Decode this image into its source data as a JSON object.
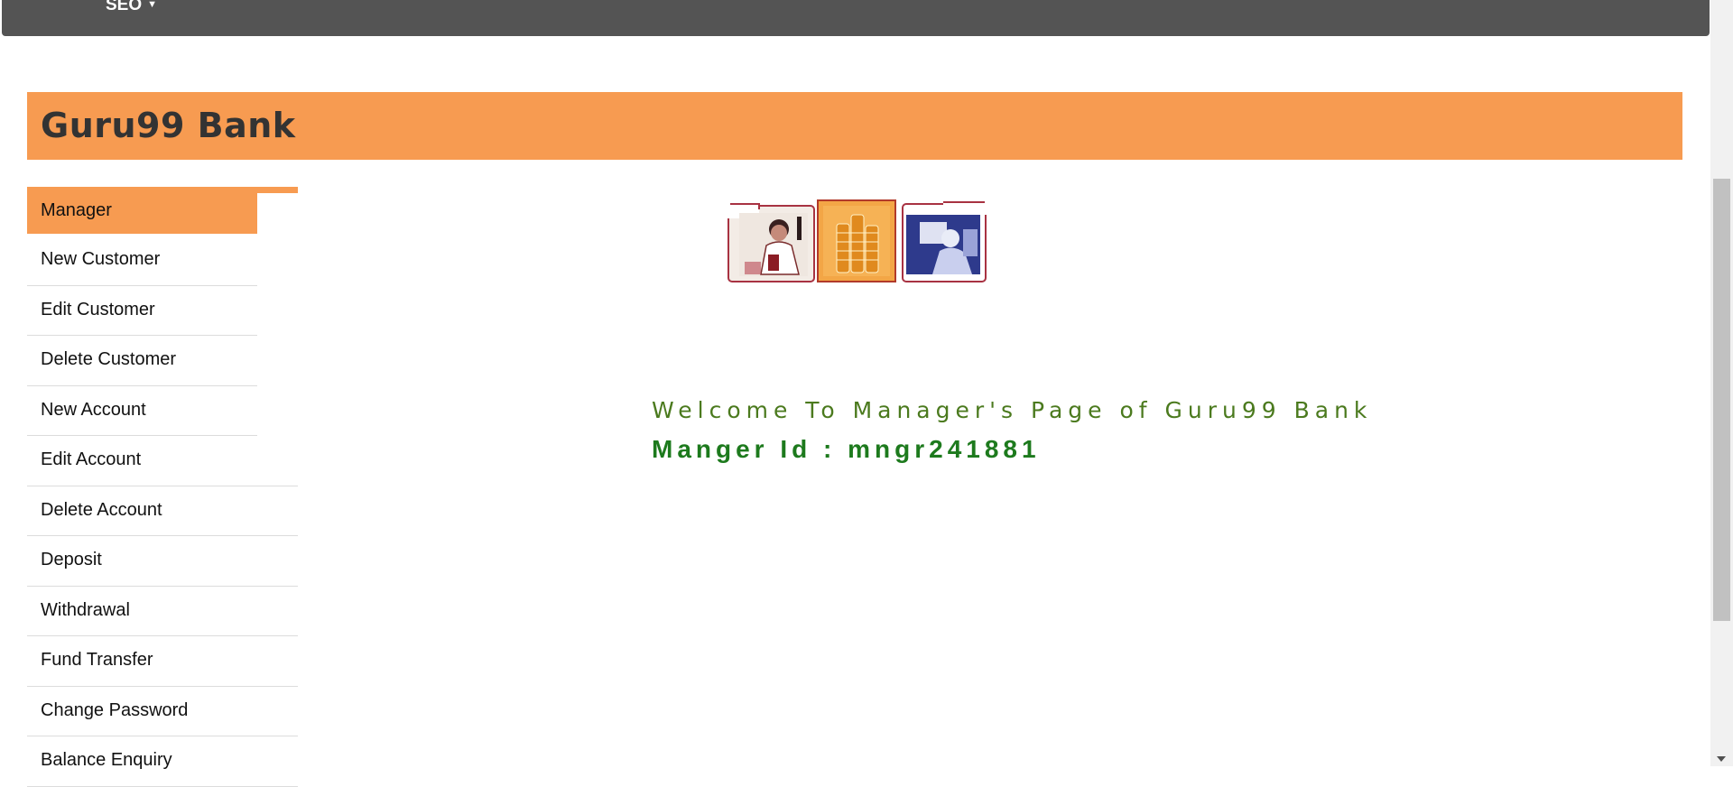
{
  "topnav": {
    "menu_label": "SEO",
    "caret_icon": "caret-down-icon"
  },
  "banner": {
    "title": "Guru99 Bank"
  },
  "sidebar": {
    "items": [
      {
        "label": "Manager"
      },
      {
        "label": "New Customer"
      },
      {
        "label": "Edit Customer"
      },
      {
        "label": "Delete Customer"
      },
      {
        "label": "New Account"
      },
      {
        "label": "Edit Account"
      },
      {
        "label": "Delete Account"
      },
      {
        "label": "Deposit"
      },
      {
        "label": "Withdrawal"
      },
      {
        "label": "Fund Transfer"
      },
      {
        "label": "Change Password"
      },
      {
        "label": "Balance Enquiry"
      }
    ]
  },
  "main": {
    "welcome_text": "Welcome To Manager's Page of Guru99 Bank",
    "manager_id_text": "Manger Id : mngr241881"
  },
  "colors": {
    "accent": "#f79b51",
    "topnav": "#545454",
    "welcome": "#4b7a1e",
    "manager_id": "#1d7a1d"
  }
}
